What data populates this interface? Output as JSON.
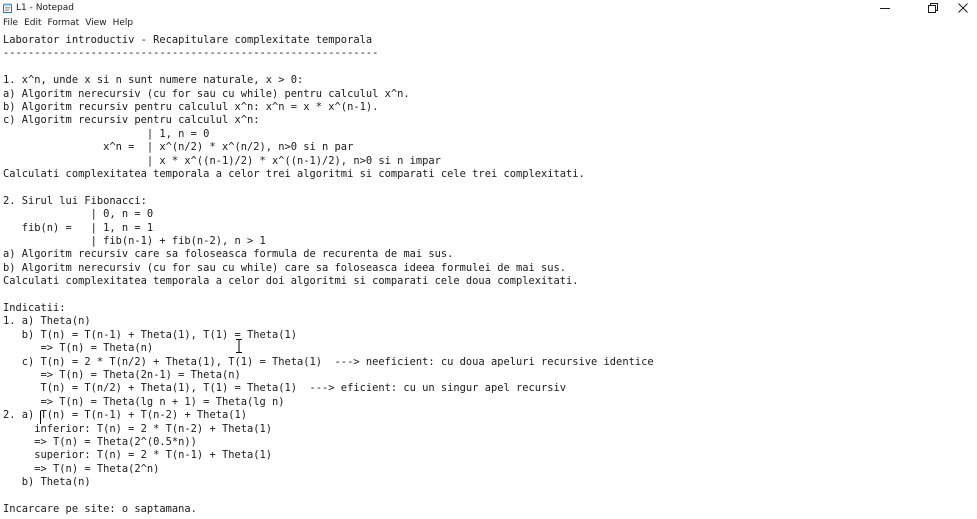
{
  "window": {
    "title": "L1 - Notepad",
    "controls": {
      "minimize_icon": "minimize-icon",
      "maximize_icon": "maximize-icon",
      "close_icon": "close-icon"
    }
  },
  "menu": {
    "items": [
      "File",
      "Edit",
      "Format",
      "View",
      "Help"
    ]
  },
  "editor": {
    "lines": [
      "Laborator introductiv - Recapitulare complexitate temporala",
      "------------------------------------------------------------",
      "",
      "1. x^n, unde x si n sunt numere naturale, x > 0:",
      "a) Algoritm nerecursiv (cu for sau cu while) pentru calculul x^n.",
      "b) Algoritm recursiv pentru calculul x^n: x^n = x * x^(n-1).",
      "c) Algoritm recursiv pentru calculul x^n:",
      "                       | 1, n = 0",
      "                x^n =  | x^(n/2) * x^(n/2), n>0 si n par",
      "                       | x * x^((n-1)/2) * x^((n-1)/2), n>0 si n impar",
      "Calculati complexitatea temporala a celor trei algoritmi si comparati cele trei complexitati.",
      "",
      "2. Sirul lui Fibonacci:",
      "              | 0, n = 0",
      "   fib(n) =   | 1, n = 1",
      "              | fib(n-1) + fib(n-2), n > 1",
      "a) Algoritm recursiv care sa foloseasca formula de recurenta de mai sus.",
      "b) Algoritm nerecursiv (cu for sau cu while) care sa foloseasca ideea formulei de mai sus.",
      "Calculati complexitatea temporala a celor doi algoritmi si comparati cele doua complexitati.",
      "",
      "Indicatii:",
      "1. a) Theta(n)",
      "   b) T(n) = T(n-1) + Theta(1), T(1) = Theta(1)",
      "      => T(n) = Theta(n)",
      "   c) T(n) = 2 * T(n/2) + Theta(1), T(1) = Theta(1)  ---> neeficient: cu doua apeluri recursive identice",
      "      => T(n) = Theta(2n-1) = Theta(n)",
      "      T(n) = T(n/2) + Theta(1), T(1) = Theta(1)  ---> eficient: cu un singur apel recursiv",
      "      => T(n) = Theta(lg n + 1) = Theta(lg n)",
      "2. a) T(n) = T(n-1) + T(n-2) + Theta(1)",
      "     inferior: T(n) = 2 * T(n-2) + Theta(1)",
      "     => T(n) = Theta(2^(0.5*n))",
      "     superior: T(n) = 2 * T(n-1) + Theta(1)",
      "     => T(n) = Theta(2^n)",
      "   b) Theta(n)",
      "",
      "Incarcare pe site: o saptamana."
    ]
  },
  "colors": {
    "background": "#ffffff",
    "text": "#1a1a1a"
  }
}
